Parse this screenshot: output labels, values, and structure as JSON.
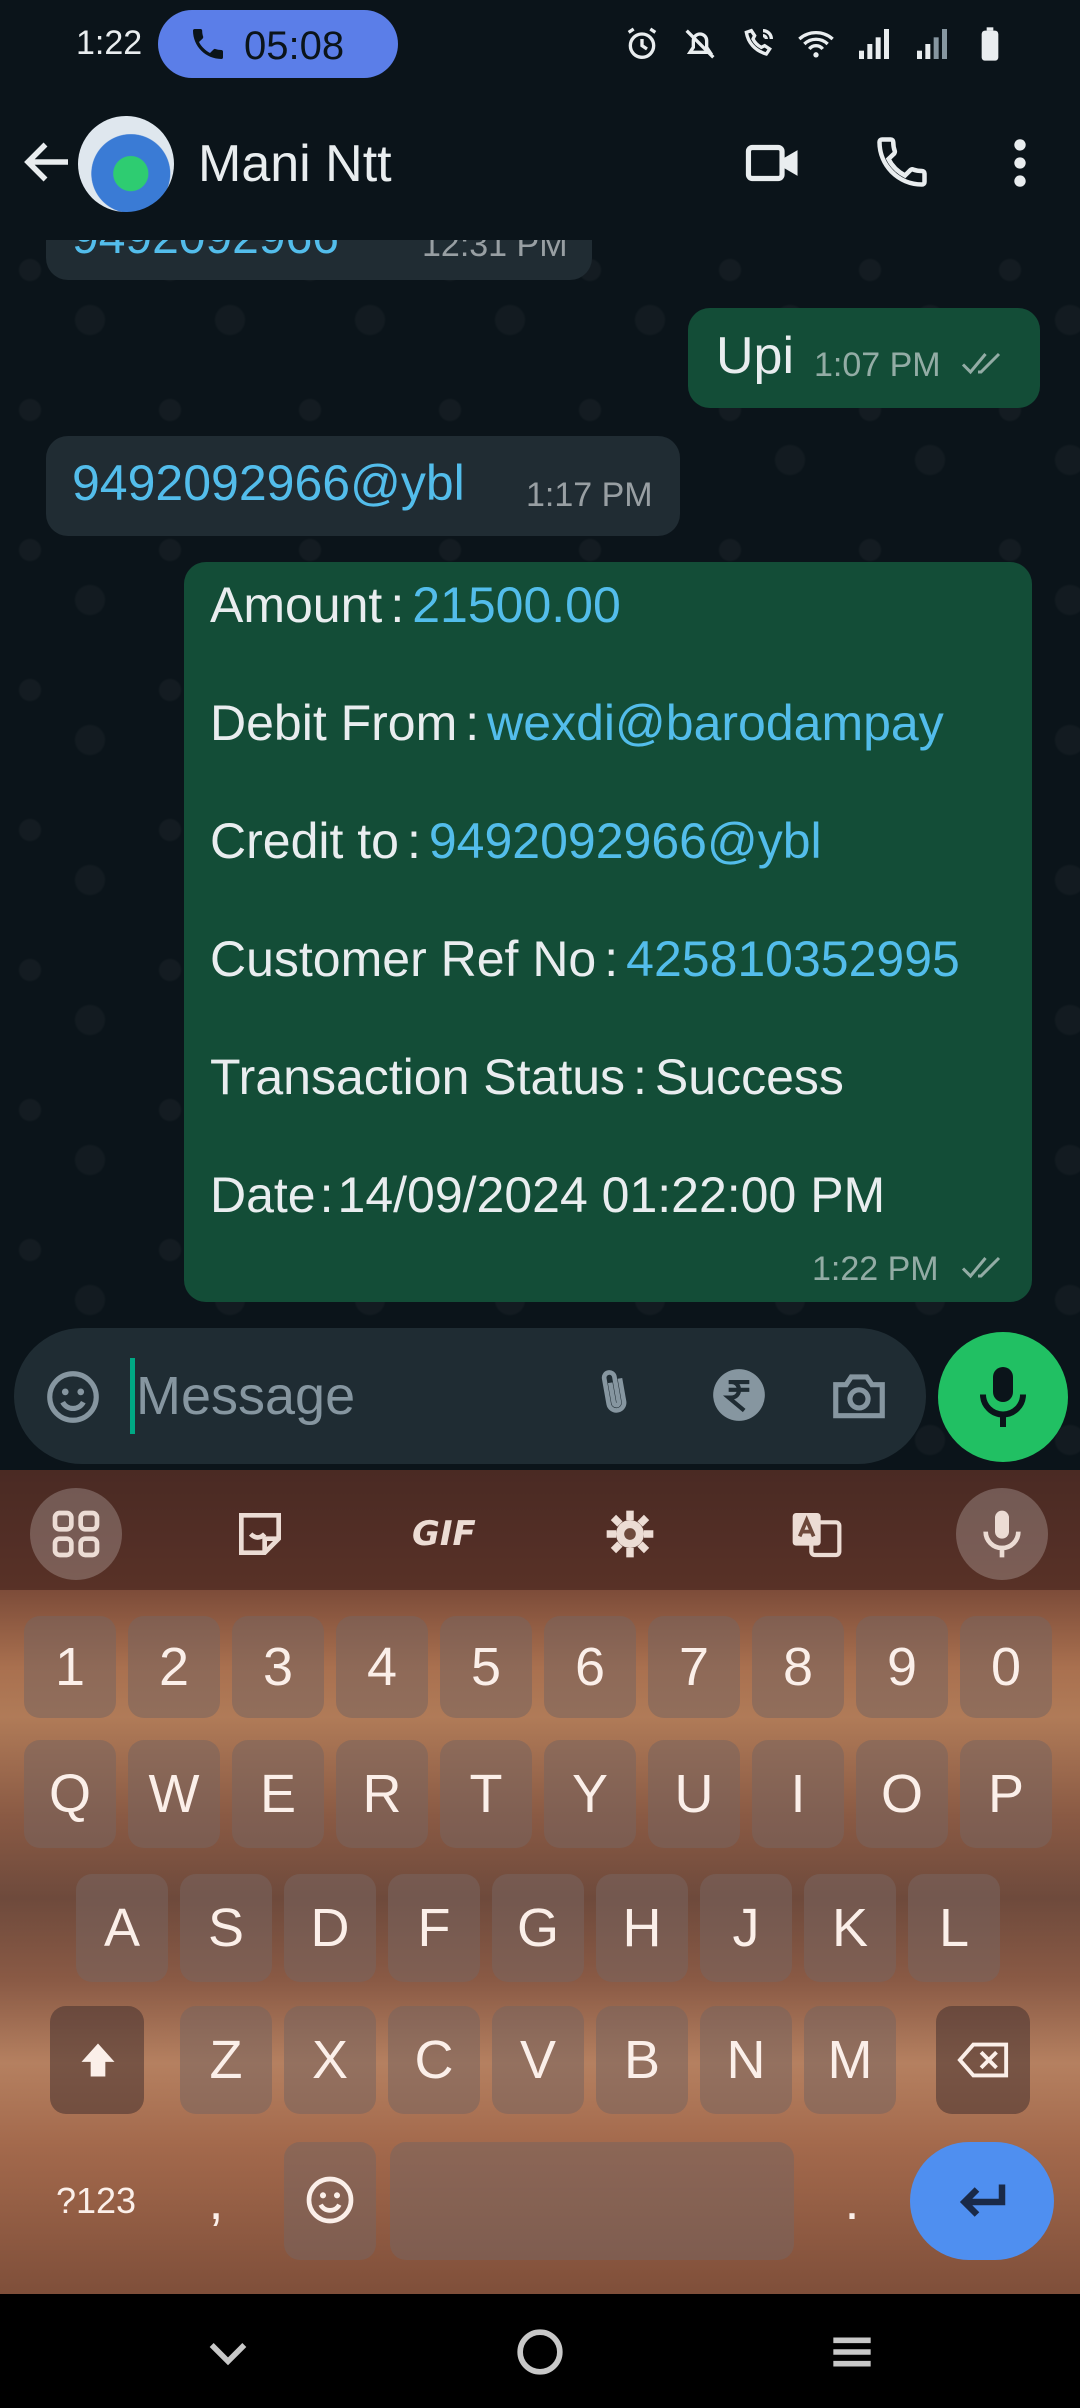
{
  "status_bar": {
    "time": "1:22",
    "call_duration": "05:08"
  },
  "header": {
    "contact_name": "Mani Ntt"
  },
  "messages": {
    "cut_off": {
      "text": "9492092966",
      "time": "12:31 PM"
    },
    "upi": {
      "text": "Upi",
      "time": "1:07 PM"
    },
    "vpa": {
      "text": "9492092966@ybl",
      "time": "1:17 PM"
    },
    "transaction": {
      "rows": [
        {
          "label": "Amount",
          "sep": ":",
          "value": "21500.00",
          "is_link": true
        },
        {
          "label": "Debit From",
          "sep": ":",
          "value": "wexdi@barodampay",
          "is_link": true
        },
        {
          "label": "Credit to",
          "sep": ":",
          "value": "9492092966@ybl",
          "is_link": true
        },
        {
          "label": "Customer Ref No",
          "sep": ":",
          "value": "425810352995",
          "is_link": true
        },
        {
          "label": "Transaction Status",
          "sep": ":",
          "value": "Success",
          "is_link": false
        },
        {
          "label": "Date",
          "sep": ":",
          "value": "14/09/2024 01:22:00 PM",
          "is_link": false
        }
      ],
      "time": "1:22 PM"
    }
  },
  "composer": {
    "placeholder": "Message"
  },
  "keyboard": {
    "toolbar": {
      "gif_label": "GIF"
    },
    "number_row": [
      "1",
      "2",
      "3",
      "4",
      "5",
      "6",
      "7",
      "8",
      "9",
      "0"
    ],
    "row1": [
      "Q",
      "W",
      "E",
      "R",
      "T",
      "Y",
      "U",
      "I",
      "O",
      "P"
    ],
    "row2": [
      "A",
      "S",
      "D",
      "F",
      "G",
      "H",
      "J",
      "K",
      "L"
    ],
    "row3": [
      "Z",
      "X",
      "C",
      "V",
      "B",
      "N",
      "M"
    ],
    "bottom": {
      "symbols": "?123",
      "comma": ",",
      "period": "."
    }
  },
  "colors": {
    "chat_bg": "#0b141a",
    "incoming_bubble": "#202c33",
    "outgoing_bubble": "#134d37",
    "link": "#53bdeb",
    "accent_green": "#21c063",
    "call_pill": "#5b7ee8",
    "enter_key": "#4f8ff0"
  }
}
